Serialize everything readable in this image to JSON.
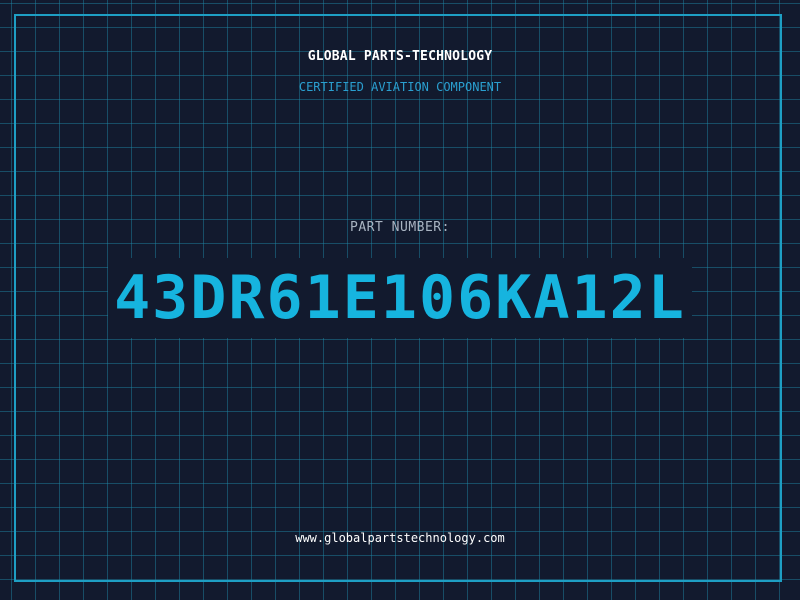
{
  "company": "GLOBAL PARTS-TECHNOLOGY",
  "subtitle": "CERTIFIED AVIATION COMPONENT",
  "part_label": "PART NUMBER:",
  "part_number": "43DR61E106KA12L",
  "website": "www.globalpartstechnology.com",
  "colors": {
    "background": "#121a2e",
    "grid": "#1e8caa",
    "frame": "#1e9fc4",
    "accent": "#16b4df",
    "subtitle": "#2a9fd0",
    "label": "#a9b4c2",
    "text": "#ffffff"
  }
}
